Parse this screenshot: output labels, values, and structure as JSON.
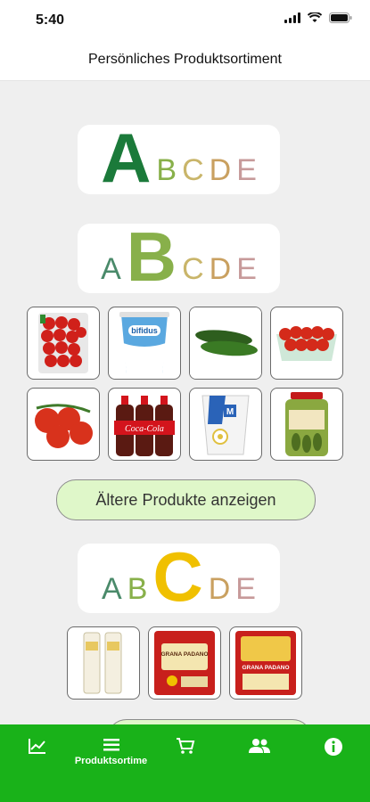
{
  "status_bar": {
    "time": "5:40"
  },
  "nav": {
    "title": "Persönliches Produktsortiment"
  },
  "score_colors": {
    "A": "#1b7a3a",
    "B": "#88b04a",
    "C": "#f0c000",
    "D": "#c9a060",
    "E": "#c79a9a"
  },
  "sections": [
    {
      "grade": "A",
      "letters": [
        "A",
        "B",
        "C",
        "D",
        "E"
      ],
      "active": "A",
      "products": []
    },
    {
      "grade": "B",
      "letters": [
        "A",
        "B",
        "C",
        "D",
        "E"
      ],
      "active": "B",
      "products": [
        "cherry-tomatoes-tray",
        "bifidus-yogurt",
        "cucumbers",
        "tomatoes-punnet",
        "vine-tomatoes",
        "coca-cola-bottles",
        "m-budget-yogurt",
        "pickles-jar"
      ],
      "more_button": "Ältere Produkte anzeigen"
    },
    {
      "grade": "C",
      "letters": [
        "A",
        "B",
        "C",
        "D",
        "E"
      ],
      "active": "C",
      "products": [
        "cheese-wedges",
        "grana-padano-grated",
        "grana-padano-pack"
      ],
      "product_labels": [
        "GRANA PADANO",
        "GRANA PADANO"
      ]
    }
  ],
  "tabs": [
    {
      "id": "statistics",
      "label": "",
      "icon": "chart-line-icon"
    },
    {
      "id": "products",
      "label": "Produktsortime",
      "icon": "list-icon"
    },
    {
      "id": "cart",
      "label": "",
      "icon": "cart-icon"
    },
    {
      "id": "community",
      "label": "",
      "icon": "people-icon"
    },
    {
      "id": "info",
      "label": "",
      "icon": "info-icon"
    }
  ]
}
